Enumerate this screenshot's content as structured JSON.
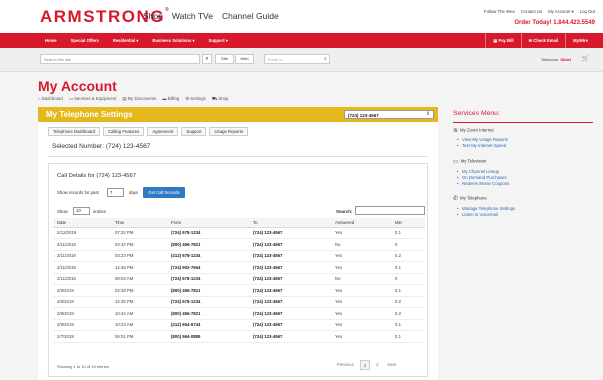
{
  "brand": {
    "logo": "ARMSTRONG",
    "logo_mark": "®"
  },
  "main_nav": [
    "Shop",
    "Watch TVe",
    "Channel Guide"
  ],
  "util_nav": [
    "Follow The Wee",
    "Contact Us",
    "My Account ▾",
    "Log Out"
  ],
  "order_today": "Order Today! 1.844.423.5549",
  "red_nav": {
    "left": [
      "Home",
      "Special Offers",
      "Residential ▾",
      "Business Solutions ▾",
      "Support ▾"
    ],
    "right": [
      "▤ Pay Bill",
      "✉ Check Email",
      "MyWire"
    ]
  },
  "search": {
    "placeholder": "Search this site",
    "site_label": "Site",
    "web_label": "Web",
    "location_placeholder": "Email to",
    "welcome_prefix": "Welcome,",
    "welcome_name": "Slidel"
  },
  "page_title": "My Account",
  "sub_nav": [
    "⌂ Dashboard",
    "▭ Services & Equipment",
    "▤ My Documents",
    "▬ Billing",
    "⚙ Settings",
    "⛟ Shop"
  ],
  "panel": {
    "title": "My Telephone Settings",
    "phone_select": "(724) 123-4567",
    "tabs": [
      "Telephone Dashboard",
      "Calling Features",
      "Agreement",
      "Support",
      "Usage Reports"
    ],
    "selected_number_label": "Selected Number:",
    "selected_number": "(724) 123-4567"
  },
  "calls": {
    "title_prefix": "Call Details for",
    "title_number": "(724) 123-4567",
    "show_records_label": "Show records for past",
    "days_value": "7",
    "days_label": "days",
    "get_button": "Get Call Records",
    "show_label": "Show",
    "entries_value": "10",
    "entries_label": "entries",
    "search_label": "Search:",
    "columns": [
      "Date",
      "Time",
      "From",
      "To",
      "Answered",
      "Min"
    ],
    "rows": [
      [
        "2/12/2019",
        "07:32 PM",
        "(724) 678-1234",
        "(724) 123-4567",
        "Yes",
        "0.1"
      ],
      [
        "2/11/2019",
        "04:42 PM",
        "(800) 456-7821",
        "(724) 123-4567",
        "No",
        "0"
      ],
      [
        "2/11/2019",
        "03:23 PM",
        "(412) 678-1234",
        "(724) 123-4567",
        "Yes",
        "0.2"
      ],
      [
        "2/11/2019",
        "12:48 PM",
        "(724) 902-7654",
        "(724) 123-4567",
        "Yes",
        "0.1"
      ],
      [
        "2/11/2019",
        "09:04 AM",
        "(724) 678-1234",
        "(724) 123-4567",
        "No",
        "0"
      ],
      [
        "2/9/2019",
        "02:28 PM",
        "(800) 456-7821",
        "(724) 123-4567",
        "Yes",
        "0.1"
      ],
      [
        "2/9/2019",
        "12:35 PM",
        "(724) 678-1234",
        "(724) 123-4567",
        "Yes",
        "0.2"
      ],
      [
        "2/9/2019",
        "10:44 AM",
        "(800) 456-7821",
        "(724) 123-4567",
        "Yes",
        "0.2"
      ],
      [
        "2/9/2019",
        "10:23 AM",
        "(412) 654-6744",
        "(724) 123-4567",
        "Yes",
        "0.1"
      ],
      [
        "2/7/2019",
        "06:01 PM",
        "(800) 564-0889",
        "(724) 123-4567",
        "Yes",
        "0.1"
      ]
    ],
    "showing": "Showing 1 to 10 of 19 entries",
    "pager": [
      "Previous",
      "1",
      "2",
      "Next"
    ]
  },
  "sidebar": {
    "title": "Services Menu:",
    "sections": [
      {
        "icon": "wifi-icon",
        "glyph": "≋",
        "label": "My Zoom Internet",
        "links": [
          "View My Usage Reports",
          "Test My Internet Speed"
        ]
      },
      {
        "icon": "tv-icon",
        "glyph": "▭",
        "label": "My Television",
        "links": [
          "My Channel Lineup",
          "On Demand Purchases",
          "Redeem Movie Coupons"
        ]
      },
      {
        "icon": "phone-icon",
        "glyph": "✆",
        "label": "My Telephone",
        "links": [
          "Manage Telephone Settings",
          "Listen to Voicemail"
        ]
      }
    ]
  },
  "colors": {
    "brand_red": "#d7192b",
    "gold": "#e5b81d",
    "link_blue": "#2b68b8",
    "button_blue": "#2e7bc4"
  }
}
